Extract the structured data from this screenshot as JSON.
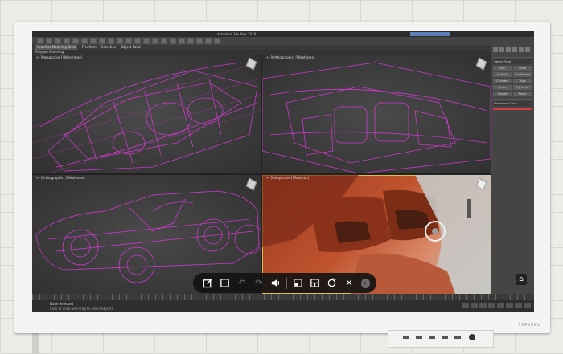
{
  "window": {
    "title": "Autodesk 3ds Max 2018",
    "search": ""
  },
  "ribbon": {
    "tabs": [
      "Graphite Modeling Tools",
      "Freeform",
      "Selection",
      "Object Paint"
    ],
    "active_tab": 0,
    "sub_label": "Polygon Modeling"
  },
  "viewports": [
    {
      "label": "[+] [Perspective] [Wireframe]",
      "mode": "wireframe"
    },
    {
      "label": "[+] [Orthographic] [Wireframe]",
      "mode": "wireframe"
    },
    {
      "label": "[+] [Orthographic] [Wireframe]",
      "mode": "wireframe"
    },
    {
      "label": "[+] [Perspective] [Realistic]",
      "mode": "realistic"
    }
  ],
  "command_panel": {
    "head1": "Object Type",
    "buttons": [
      "Box",
      "Cone",
      "Sphere",
      "GeoSphere",
      "Cylinder",
      "Tube",
      "Torus",
      "Pyramid",
      "Teapot",
      "Plane"
    ],
    "head2": "Name and Color"
  },
  "status": {
    "selection": "None Selected",
    "prompt": "Click or click-and-drag to select objects"
  },
  "touch_toolbar": {
    "items": [
      {
        "name": "edit-icon",
        "glyph": ""
      },
      {
        "name": "select-box-icon",
        "glyph": ""
      },
      {
        "name": "undo-icon",
        "glyph": "↶"
      },
      {
        "name": "redo-icon",
        "glyph": "↷"
      },
      {
        "name": "volume-icon",
        "glyph": ""
      },
      {
        "name": "window-icon",
        "glyph": ""
      },
      {
        "name": "layout-icon",
        "glyph": ""
      },
      {
        "name": "rotate-icon",
        "glyph": ""
      },
      {
        "name": "close-icon",
        "glyph": "✕"
      },
      {
        "name": "more-icon",
        "glyph": ""
      }
    ]
  },
  "monitor": {
    "brand": "SAMSUNG"
  },
  "colors": {
    "wireframe": "#d83ad8",
    "active_border": "#d8c04a",
    "viewport_bg": "#3a3a3a"
  }
}
